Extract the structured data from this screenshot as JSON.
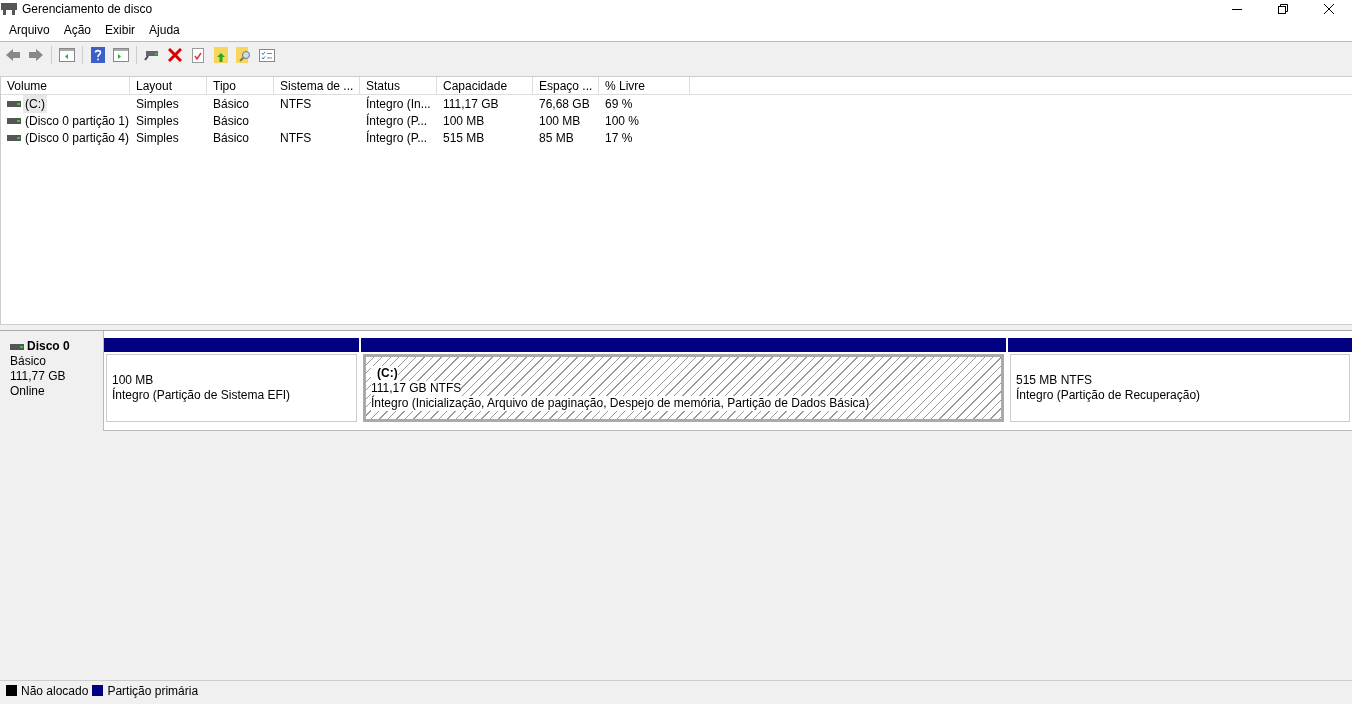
{
  "window": {
    "title": "Gerenciamento de disco"
  },
  "menu": [
    "Arquivo",
    "Ação",
    "Exibir",
    "Ajuda"
  ],
  "table": {
    "columns": [
      "Volume",
      "Layout",
      "Tipo",
      "Sistema de ...",
      "Status",
      "Capacidade",
      "Espaço ...",
      "% Livre"
    ],
    "rows": [
      {
        "selected": true,
        "cells": [
          "(C:)",
          "Simples",
          "Básico",
          "NTFS",
          "Íntegro (In...",
          "111,17 GB",
          "76,68 GB",
          "69 %"
        ]
      },
      {
        "selected": false,
        "cells": [
          "(Disco 0 partição 1)",
          "Simples",
          "Básico",
          "",
          "Íntegro (P...",
          "100 MB",
          "100 MB",
          "100 %"
        ]
      },
      {
        "selected": false,
        "cells": [
          "(Disco 0 partição 4)",
          "Simples",
          "Básico",
          "NTFS",
          "Íntegro (P...",
          "515 MB",
          "85 MB",
          "17 %"
        ]
      }
    ]
  },
  "disk": {
    "name": "Disco 0",
    "type": "Básico",
    "size": "111,77 GB",
    "state": "Online",
    "partitions": [
      {
        "selected": false,
        "size": "100 MB",
        "status": "Íntegro (Partição de Sistema EFI)"
      },
      {
        "selected": true,
        "label": "(C:)",
        "size": "111,17 GB NTFS",
        "status": "Íntegro (Inicialização, Arquivo de paginação, Despejo de memória, Partição de Dados Básica)"
      },
      {
        "selected": false,
        "size": "515 MB NTFS",
        "status": "Íntegro (Partição de Recuperação)"
      }
    ]
  },
  "legend": [
    {
      "label": "Não alocado",
      "color": "#000000"
    },
    {
      "label": "Partição primária",
      "color": "#000080"
    }
  ]
}
